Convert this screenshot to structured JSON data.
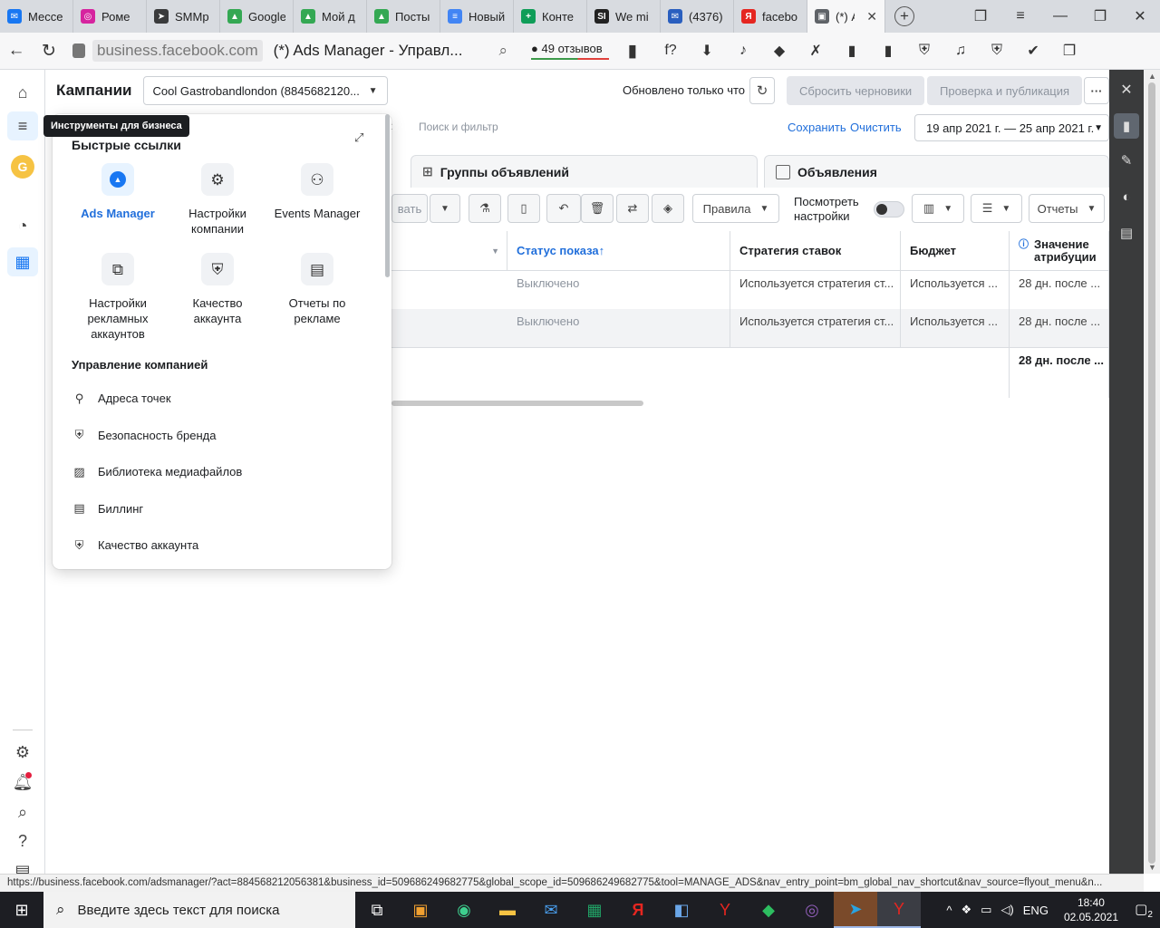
{
  "browser": {
    "tabs": [
      {
        "label": "Мессе",
        "color": "#1877f2",
        "glyph": "✉"
      },
      {
        "label": "Роме",
        "color": "#d6249f",
        "glyph": "◎"
      },
      {
        "label": "SMMр",
        "color": "#3a3b3c",
        "glyph": "➤"
      },
      {
        "label": "Google",
        "color": "#34a853",
        "glyph": "▲"
      },
      {
        "label": "Мой д",
        "color": "#34a853",
        "glyph": "▲"
      },
      {
        "label": "Посты",
        "color": "#34a853",
        "glyph": "▲"
      },
      {
        "label": "Новый",
        "color": "#4285f4",
        "glyph": "≡"
      },
      {
        "label": "Конте",
        "color": "#0f9d58",
        "glyph": "+"
      },
      {
        "label": "We mi",
        "color": "#222222",
        "glyph": "SI"
      },
      {
        "label": "(4376)",
        "color": "#2a5fbf",
        "glyph": "✉"
      },
      {
        "label": "facebo",
        "color": "#e52620",
        "glyph": "Я"
      }
    ],
    "active_tab": "(*) А",
    "url_domain": "business.facebook.com",
    "page_title": "(*) Ads Manager - Управл...",
    "reviews_label": "49 отзывов",
    "extension_icons": [
      "f?",
      "⬇",
      "♪",
      "◆",
      "✗",
      "▮",
      "▮",
      "⛨",
      "♫",
      "⛨",
      "✔",
      "❐"
    ]
  },
  "rail": {
    "tooltip": "Инструменты для бизнеса",
    "avatar_letter": "G"
  },
  "header": {
    "title": "Кампании",
    "account": "Cool Gastrobandlondon (8845682120...",
    "updated": "Обновлено только что",
    "discard": "Сбросить черновики",
    "publish": "Проверка и публикация",
    "more": "···"
  },
  "filter": {
    "placeholder": "Поиск и фильтр",
    "save": "Сохранить",
    "clear": "Очистить",
    "date_range": "19 апр 2021 г. — 25 апр 2021 г."
  },
  "levels": {
    "adsets": "Группы объявлений",
    "ads": "Объявления"
  },
  "toolbar": {
    "partial_button": "вать",
    "rules": "Правила",
    "view_settings": "Посмотреть настройки",
    "reports": "Отчеты"
  },
  "table": {
    "headers": {
      "status": "Статус показа",
      "status_arrow": "↑",
      "bid": "Стратегия ставок",
      "budget": "Бюджет",
      "attribution": "Значение атрибуции"
    },
    "rows": [
      {
        "status": "Выключено",
        "bid": "Используется стратегия ст...",
        "budget": "Используется ...",
        "attribution": "28 дн. после ..."
      },
      {
        "status": "Выключено",
        "bid": "Используется стратегия ст...",
        "budget": "Используется ...",
        "attribution": "28 дн. после ..."
      }
    ],
    "total_attribution": "28 дн. после ..."
  },
  "flyout": {
    "quick_links_title": "Быстрые ссылки",
    "quick_links": [
      {
        "label": "Ads Manager",
        "icon": "ads-manager-icon"
      },
      {
        "label": "Настройки компании",
        "icon": "gear-icon"
      },
      {
        "label": "Events Manager",
        "icon": "events-icon"
      },
      {
        "label": "Настройки рекламных аккаунтов",
        "icon": "ad-accounts-icon"
      },
      {
        "label": "Качество аккаунта",
        "icon": "shield-icon"
      },
      {
        "label": "Отчеты по рекламе",
        "icon": "reports-icon"
      }
    ],
    "manage_title": "Управление компанией",
    "manage_items": [
      {
        "label": "Адреса точек",
        "icon": "location-icon"
      },
      {
        "label": "Безопасность бренда",
        "icon": "shield-icon"
      },
      {
        "label": "Библиотека медиафайлов",
        "icon": "media-icon"
      },
      {
        "label": "Биллинг",
        "icon": "billing-icon"
      },
      {
        "label": "Качество аккаунта",
        "icon": "shield-icon"
      }
    ]
  },
  "status_url": "https://business.facebook.com/adsmanager/?act=884568212056381&business_id=509686249682775&global_scope_id=509686249682775&tool=MANAGE_ADS&nav_entry_point=bm_global_nav_shortcut&nav_source=flyout_menu&n...",
  "taskbar": {
    "search_placeholder": "Введите здесь текст для поиска",
    "lang": "ENG",
    "time": "18:40",
    "date": "02.05.2021",
    "notifications": "2"
  }
}
